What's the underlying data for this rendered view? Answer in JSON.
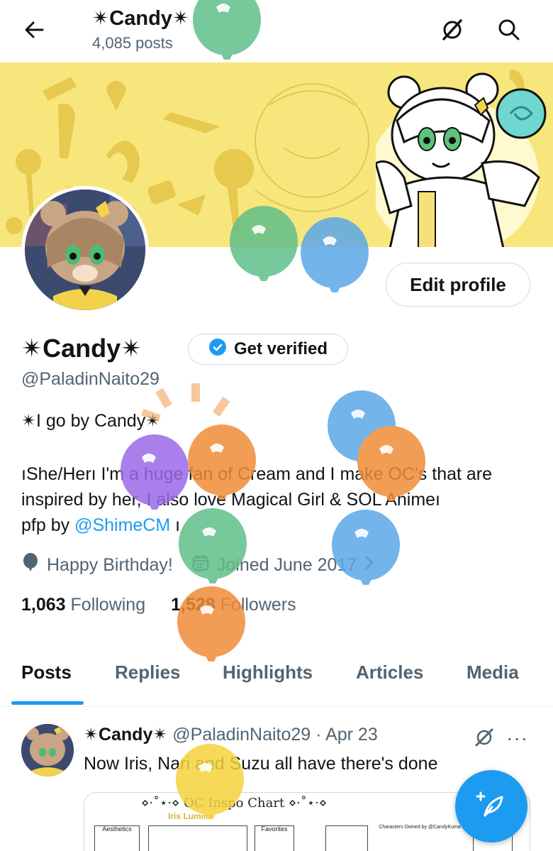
{
  "header": {
    "title": "✴Candy✴",
    "post_count": "4,085 posts"
  },
  "profile": {
    "edit_label": "Edit profile",
    "display_name": "✴Candy✴",
    "verify_label": "Get verified",
    "handle": "@PaladinNaito29",
    "bio_line1": "✴I go by Candy✴",
    "bio_line2": "ıShe/Herı I'm a huge fan of Cream and I make OC's that are inspired by her, I also love Magical Girl & SOL Animeı",
    "bio_line3_prefix": "pfp by ",
    "bio_mention": "@ShimeCM",
    "bio_line3_suffix": " ı",
    "birthday": "Happy Birthday!",
    "joined": "Joined June 2017",
    "following_count": "1,063",
    "following_label": "Following",
    "followers_count": "1,528",
    "followers_label": "Followers"
  },
  "tabs": [
    {
      "label": "Posts",
      "active": true
    },
    {
      "label": "Replies",
      "active": false
    },
    {
      "label": "Highlights",
      "active": false
    },
    {
      "label": "Articles",
      "active": false
    },
    {
      "label": "Media",
      "active": false
    }
  ],
  "post": {
    "author_name": "✴Candy✴",
    "author_handle": "@PaladinNaito29",
    "date": "· Apr 23",
    "text": "Now Iris, Nari and Suzu all have there's done",
    "more": "···",
    "media": {
      "title": "⋄·˚⋆·⋄ OC Inspo Chart ⋄·˚⋆·⋄",
      "subtitle": "Iris Lumina",
      "box1": "Aesthetics",
      "box2": "Favorites",
      "box3": "Characters Owned by @CandyKuma"
    }
  },
  "colors": {
    "accent": "#1d9bf0",
    "banner": "#f7e67c",
    "balloon_green": "#5fbf88",
    "balloon_blue": "#5aa7e8",
    "balloon_orange": "#ef8c38",
    "balloon_purple": "#9a6ae8",
    "balloon_yellow": "#f5d23c"
  },
  "icons": [
    "back-arrow-icon",
    "grok-icon",
    "search-icon",
    "verified-badge-icon",
    "balloon-icon",
    "calendar-icon",
    "chevron-right-icon",
    "compose-post-icon"
  ]
}
